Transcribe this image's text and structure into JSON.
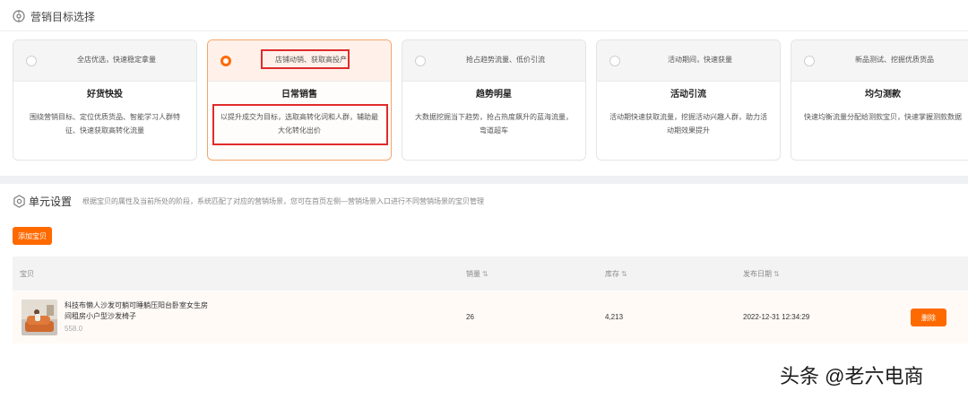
{
  "section_title": "营销目标选择",
  "cards": [
    {
      "tag": "全店优选，快速稳定拿量",
      "name": "好货快投",
      "desc": "围绕营销目标、定位优质货品、智能学习人群特征、快速获取高转化流量",
      "selected": false
    },
    {
      "tag": "店铺动销、获取高投产",
      "name": "日常销售",
      "desc": "以提升成交为目标，选取高转化词和人群，辅助最大化转化出价",
      "selected": true
    },
    {
      "tag": "抢占趋势流量、低价引流",
      "name": "趋势明星",
      "desc": "大数据挖掘当下趋势，抢占热度飙升的蓝海流量，弯道超车",
      "selected": false
    },
    {
      "tag": "活动期间，快速获量",
      "name": "活动引流",
      "desc": "活动期快速获取流量，挖掘活动兴趣人群，助力活动期效果提升",
      "selected": false
    },
    {
      "tag": "新品测试、挖掘优质货品",
      "name": "均匀测款",
      "desc": "快速均衡流量分配给测款宝贝，快速掌握测款数据",
      "selected": false
    }
  ],
  "unit": {
    "title": "单元设置",
    "hint": "根据宝贝的属性及当前所处的阶段，系统匹配了对应的营销场景，您可在首页左侧—营销场景入口进行不同营销场景的宝贝管理",
    "add_button": "添加宝贝"
  },
  "table": {
    "headers": {
      "item": "宝贝",
      "sales": "销量",
      "stock": "库存",
      "date": "发布日期"
    },
    "sort_glyph": "⇅",
    "rows": [
      {
        "title": "科技布懒人沙发可躺可睡躺压阳台卧室女生房间租房小户型沙发椅子",
        "price": "558.0",
        "sales": "26",
        "stock": "4,213",
        "date": "2022-12-31 12:34:29",
        "action": "删除"
      }
    ]
  },
  "watermark": "头条 @老六电商",
  "colors": {
    "accent": "#ff6a00",
    "highlight": "#e02b2b"
  }
}
